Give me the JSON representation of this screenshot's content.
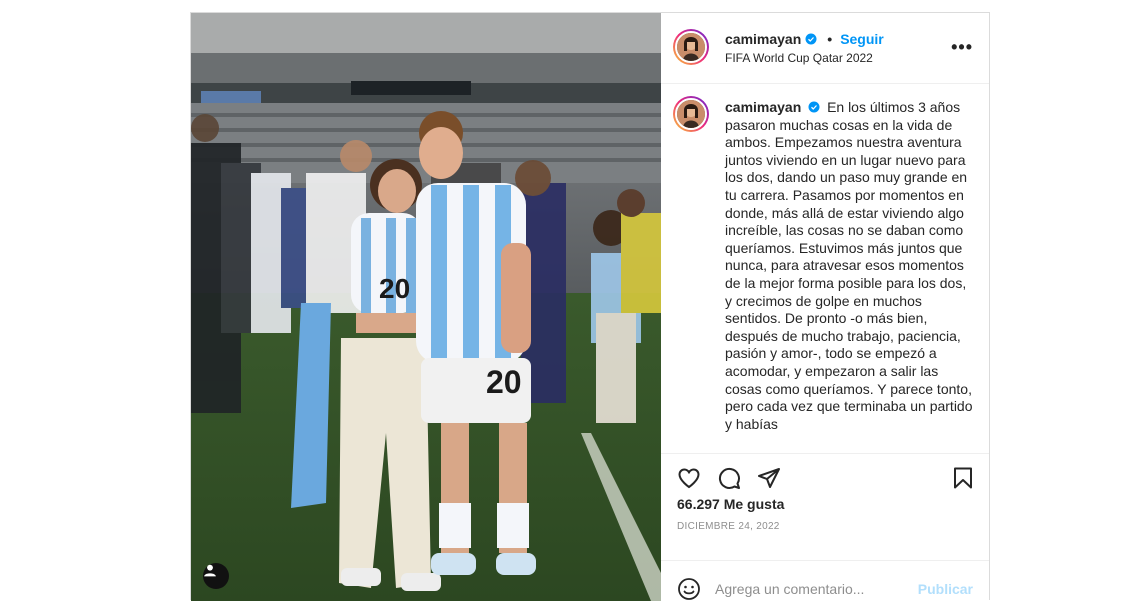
{
  "post": {
    "username": "camimayan",
    "follow_label": "Seguir",
    "location": "FIFA World Cup Qatar 2022",
    "more_label": "•••",
    "caption_text": "En los últimos 3 años pasaron muchas cosas en la vida de ambos. Empezamos nuestra aventura juntos viviendo en un lugar nuevo para los dos, dando un paso muy grande en tu carrera. Pasamos por momentos en donde, más allá de estar viviendo algo increíble, las cosas no se daban como queríamos. Estuvimos más juntos que nunca, para atravesar esos momentos de la mejor forma posible para los dos, y crecimos de golpe en muchos sentidos. De pronto -o más bien, después de mucho trabajo, paciencia, pasión y amor-, todo se empezó a acomodar, y empezaron a salir las cosas como queríamos. Y parece tonto, pero cada vez que terminaba un partido y habías",
    "likes": "66.297 Me gusta",
    "date": "DICIEMBRE 24, 2022",
    "comment_placeholder": "Agrega un comentario...",
    "publish_label": "Publicar"
  },
  "photo": {
    "jersey_number_left": "20",
    "jersey_number_right": "20"
  },
  "icons": {
    "verified": "verified-badge-icon",
    "like": "heart-icon",
    "comment": "comment-icon",
    "share": "paper-plane-icon",
    "save": "bookmark-icon",
    "emoji": "smiley-icon",
    "tag": "person-tag-icon"
  },
  "colors": {
    "accent": "#0095f6",
    "publish_disabled": "#b2dffc",
    "text": "#262626",
    "muted": "#8e8e8e"
  }
}
